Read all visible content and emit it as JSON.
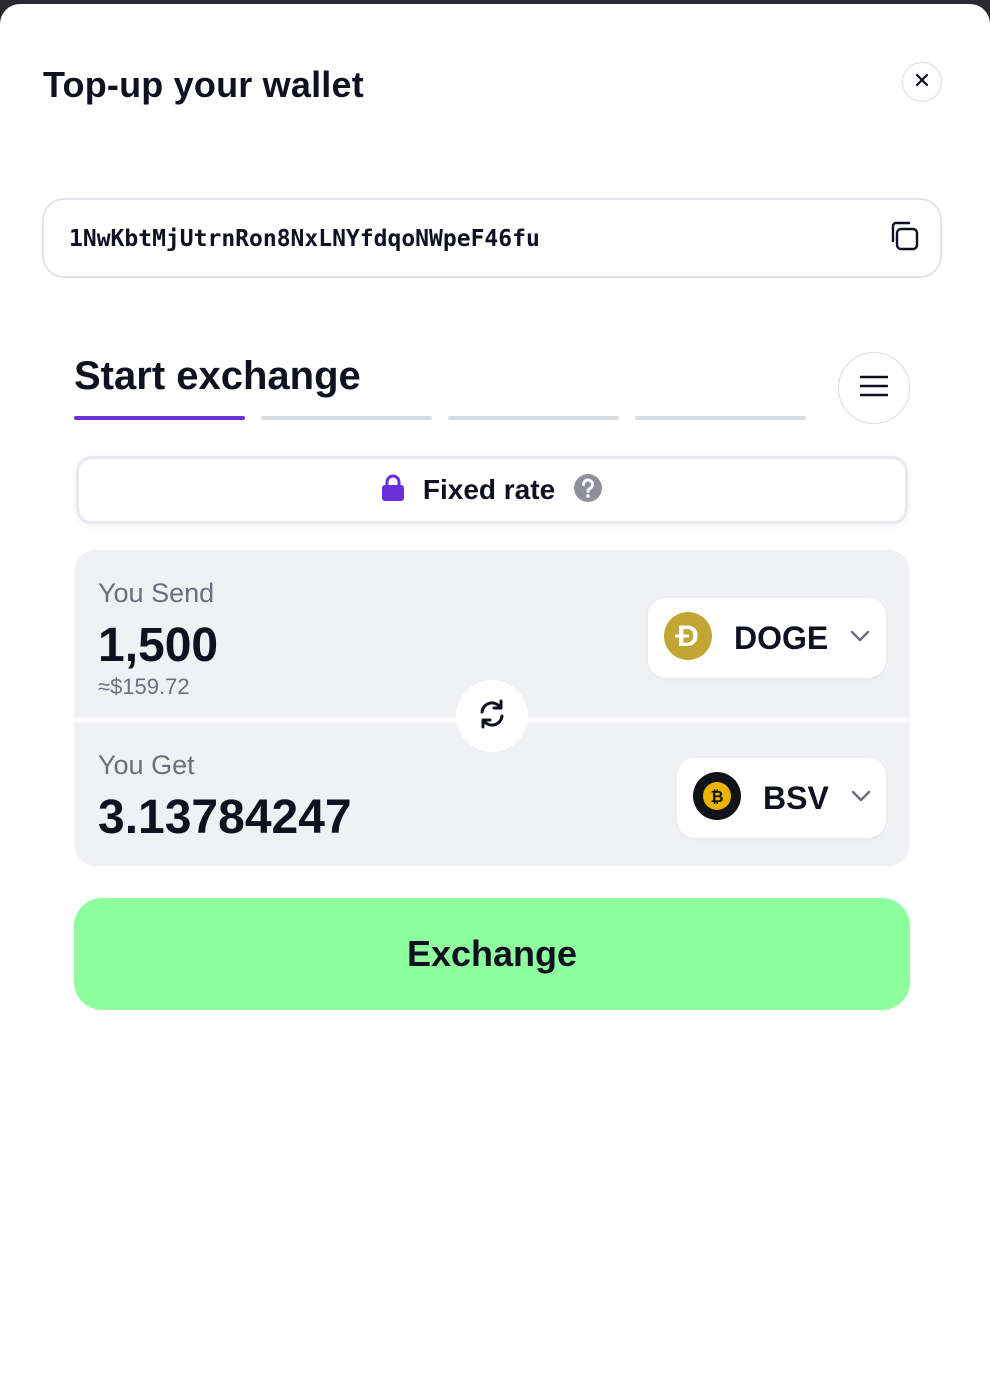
{
  "modal": {
    "title": "Top-up your wallet"
  },
  "wallet": {
    "address": "1NwKbtMjUtrnRon8NxLNYfdqoNWpeF46fu"
  },
  "exchange": {
    "title": "Start exchange",
    "steps_total": 4,
    "current_step": 1,
    "rate_mode": "Fixed rate",
    "send": {
      "label": "You Send",
      "amount": "1,500",
      "usd_estimate": "≈$159.72",
      "coin": "DOGE"
    },
    "get": {
      "label": "You Get",
      "amount": "3.13784247",
      "coin": "BSV"
    },
    "submit_label": "Exchange"
  },
  "icons": {
    "close": "close-icon",
    "copy": "copy-icon",
    "menu": "hamburger-menu-icon",
    "lock": "lock-icon",
    "help": "help-icon",
    "doge": "doge-coin-icon",
    "bsv": "bsv-coin-icon",
    "chevron": "chevron-down-icon",
    "swap": "swap-icon"
  },
  "colors": {
    "accent": "#6a30d9",
    "exchange_button": "#8dfd9e",
    "doge": "#c2a633",
    "bsv": "#eab300"
  }
}
